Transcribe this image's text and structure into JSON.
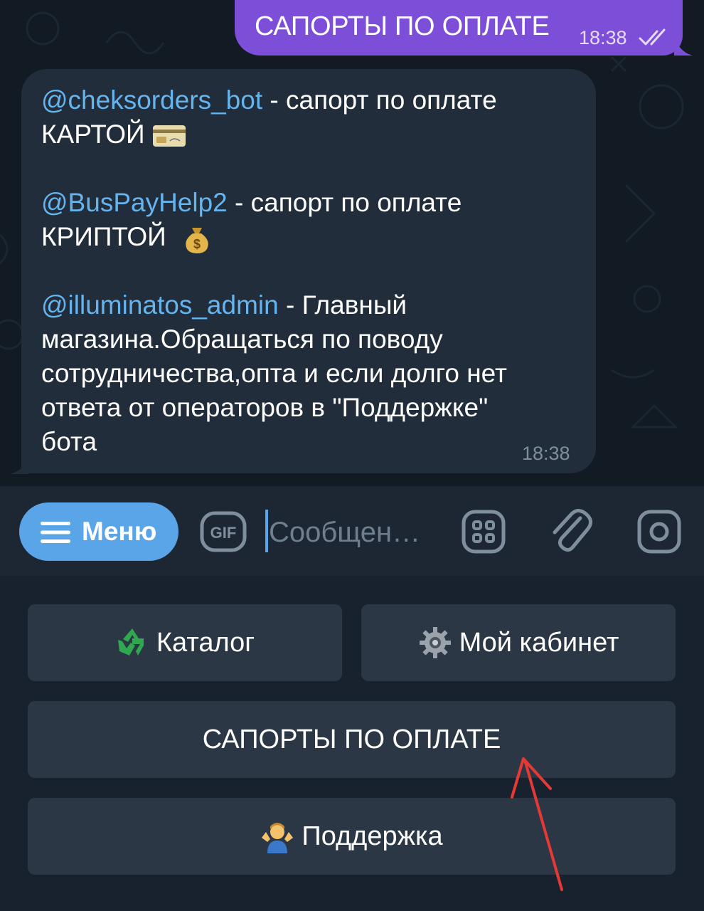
{
  "chat": {
    "outgoing": {
      "text": "САПОРТЫ ПО ОПЛАТЕ",
      "time": "18:38",
      "status_icon": "double-check-icon"
    },
    "incoming": {
      "lines": [
        {
          "mention": "@cheksorders_bot",
          "text": " - сапорт по оплате"
        },
        {
          "text": "КАРТОЙ",
          "emoji": "credit-card-icon"
        },
        {
          "mention": "@BusPayHelp2",
          "text": " - сапорт по оплате"
        },
        {
          "text": "КРИПТОЙ",
          "emoji": "money-bag-icon"
        },
        {
          "mention": "@illuminatos_admin",
          "text": " - Главный"
        },
        {
          "text": "магазина.Обращаться по поводу"
        },
        {
          "text": "сотрудничества,опта и если долго нет"
        },
        {
          "text": "ответа от операторов в \"Поддержке\""
        },
        {
          "text": "бота"
        }
      ],
      "time": "18:38"
    }
  },
  "input_bar": {
    "menu_label": "Меню",
    "gif_label": "GIF",
    "placeholder": "Сообщен…"
  },
  "keyboard": {
    "catalog": "Каталог",
    "cabinet": "Мой кабинет",
    "payments": "САПОРТЫ ПО ОПЛАТЕ",
    "support": "Поддержка"
  },
  "colors": {
    "outgoing_bubble": "#7d4fd8",
    "incoming_bubble": "#212d3b",
    "mention": "#65b4ee",
    "menu_button": "#5aa4e8",
    "keyboard_button": "#2b3745",
    "annotation_arrow": "#e53935"
  }
}
